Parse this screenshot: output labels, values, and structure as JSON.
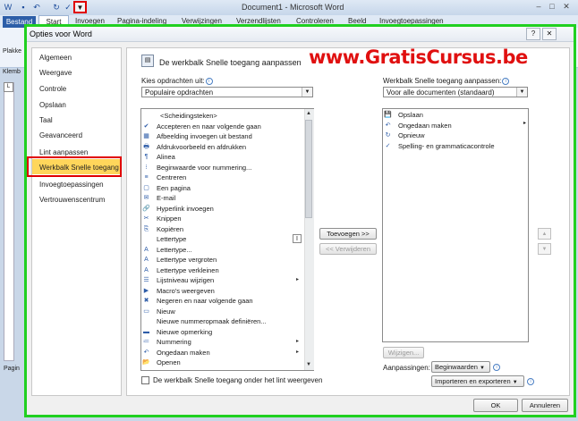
{
  "word": {
    "title": "Document1 - Microsoft Word",
    "file_tab": "Bestand",
    "tabs": [
      "Start",
      "Invoegen",
      "Pagina-indeling",
      "Verwijzingen",
      "Verzendlijsten",
      "Controleren",
      "Beeld",
      "Invoegtoepassingen"
    ],
    "paste_label": "Plakke",
    "clipboard_label": "Klemb",
    "page_label": "Pagin"
  },
  "dialog": {
    "title": "Opties voor Word",
    "help": "?",
    "close": "✕",
    "nav": [
      "Algemeen",
      "Weergave",
      "Controle",
      "Opslaan",
      "Taal",
      "Geavanceerd",
      "Lint aanpassen",
      "Werkbalk Snelle toegang",
      "Invoegtoepassingen",
      "Vertrouwenscentrum"
    ],
    "selected_nav": "Werkbalk Snelle toegang",
    "content_title": "De werkbalk Snelle toegang aanpassen",
    "watermark": "www.GratisCursus.be",
    "choose_label": "Kies opdrachten uit:",
    "choose_value": "Populaire opdrachten",
    "qat_label": "Werkbalk Snelle toegang aanpassen:",
    "qat_value": "Voor alle documenten (standaard)",
    "commands": [
      {
        "icon": "",
        "label": "<Scheidingsteken>"
      },
      {
        "icon": "✔",
        "label": "Accepteren en naar volgende gaan"
      },
      {
        "icon": "▦",
        "label": "Afbeelding invoegen uit bestand"
      },
      {
        "icon": "🖶",
        "label": "Afdrukvoorbeeld en afdrukken"
      },
      {
        "icon": "¶",
        "label": "Alinea"
      },
      {
        "icon": "⁝",
        "label": "Beginwaarde voor nummering..."
      },
      {
        "icon": "≡",
        "label": "Centreren"
      },
      {
        "icon": "▢",
        "label": "Een pagina"
      },
      {
        "icon": "✉",
        "label": "E-mail"
      },
      {
        "icon": "🔗",
        "label": "Hyperlink invoegen"
      },
      {
        "icon": "✂",
        "label": "Knippen"
      },
      {
        "icon": "⎘",
        "label": "Kopiëren"
      },
      {
        "icon": "",
        "label": "Lettertype"
      },
      {
        "icon": "A",
        "label": "Lettertype..."
      },
      {
        "icon": "A",
        "label": "Lettertype vergroten"
      },
      {
        "icon": "A",
        "label": "Lettertype verkleinen"
      },
      {
        "icon": "☰",
        "label": "Lijstniveau wijzigen"
      },
      {
        "icon": "▶",
        "label": "Macro's weergeven"
      },
      {
        "icon": "✖",
        "label": "Negeren en naar volgende gaan"
      },
      {
        "icon": "▭",
        "label": "Nieuw"
      },
      {
        "icon": "",
        "label": "Nieuwe nummeropmaak definiëren..."
      },
      {
        "icon": "▬",
        "label": "Nieuwe opmerking"
      },
      {
        "icon": "≔",
        "label": "Nummering"
      },
      {
        "icon": "↶",
        "label": "Ongedaan maken"
      },
      {
        "icon": "📂",
        "label": "Openen"
      }
    ],
    "command_submenu_glyph": "▸",
    "font_field_glyph": "I",
    "qat_items": [
      {
        "icon": "💾",
        "label": "Opslaan"
      },
      {
        "icon": "↶",
        "label": "Ongedaan maken"
      },
      {
        "icon": "↻",
        "label": "Opnieuw"
      },
      {
        "icon": "✓",
        "label": "Spelling- en grammaticacontrole"
      }
    ],
    "add_button": "Toevoegen >>",
    "remove_button": "<< Verwijderen",
    "modify_button": "Wijzigen...",
    "customizations_label": "Aanpassingen:",
    "reset_button": "Beginwaarden",
    "import_export_button": "Importeren en exporteren",
    "show_below_ribbon": "De werkbalk Snelle toegang onder het lint weergeven",
    "ok_button": "OK",
    "cancel_button": "Annuleren",
    "move_up": "▲",
    "move_down": "▼",
    "info_glyph": "i",
    "dropdown_glyph": "▼"
  }
}
